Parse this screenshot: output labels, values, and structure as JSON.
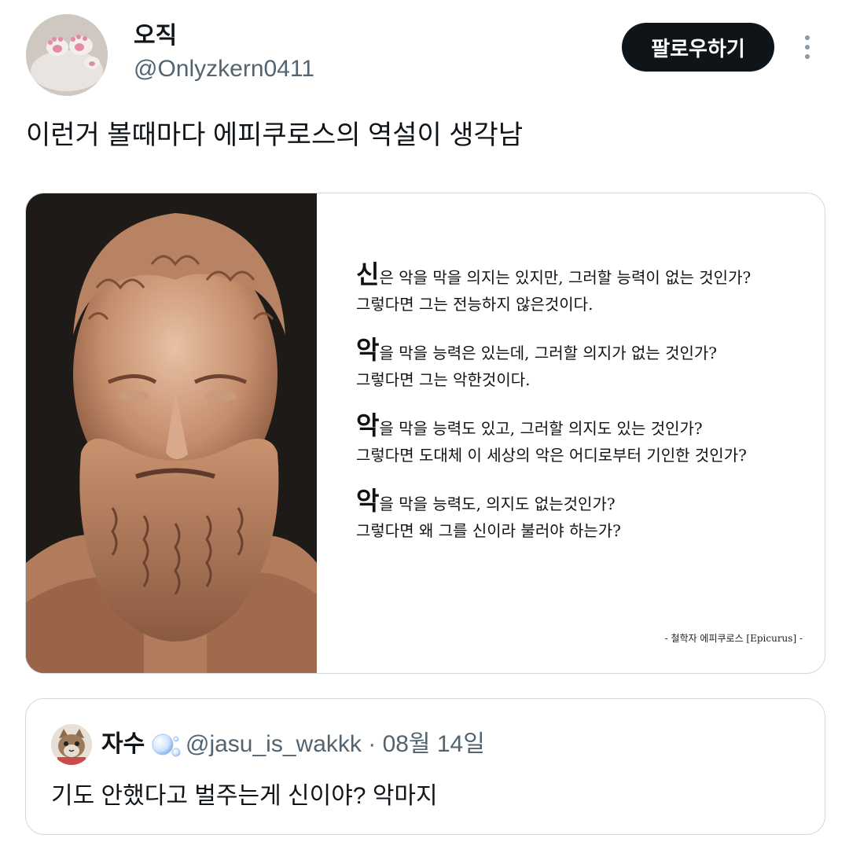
{
  "author": {
    "display_name": "오직",
    "handle": "@Onlyzkern0411",
    "avatar_icon": "avatar-cat-paws"
  },
  "follow_button_label": "팔로우하기",
  "more_icon": "more-vertical-icon",
  "tweet_text": "이런거 볼때마다 에피쿠로스의 역설이 생각남",
  "media": {
    "quote_lines": [
      {
        "big": "신",
        "rest": "은 악을 막을 의지는 있지만, 그러할 능력이 없는 것인가?",
        "second": "그렇다면 그는 전능하지 않은것이다."
      },
      {
        "big": "악",
        "rest": "을 막을 능력은 있는데, 그러할 의지가 없는 것인가?",
        "second": "그렇다면 그는 악한것이다."
      },
      {
        "big": "악",
        "rest": "을 막을 능력도 있고, 그러할 의지도 있는 것인가?",
        "second": "그렇다면 도대체 이 세상의 악은 어디로부터 기인한 것인가?"
      },
      {
        "big": "악",
        "rest": "을 막을 능력도, 의지도 없는것인가?",
        "second": "그렇다면 왜 그를 신이라 불러야 하는가?"
      }
    ],
    "attribution": "- 철학자 에피쿠로스 [Epicurus] -"
  },
  "quoted_tweet": {
    "name": "자수",
    "handle": "@jasu_is_wakkk",
    "separator": "·",
    "date": "08월 14일",
    "text": "기도 안했다고 벌주는게 신이야? 악마지",
    "avatar_icon": "avatar-cat-cartoon",
    "name_emoji_icon": "bubbles-icon"
  },
  "colors": {
    "text_primary": "#0f1419",
    "text_secondary": "#536471",
    "border": "#cfd9de",
    "follow_bg": "#0f1419"
  }
}
